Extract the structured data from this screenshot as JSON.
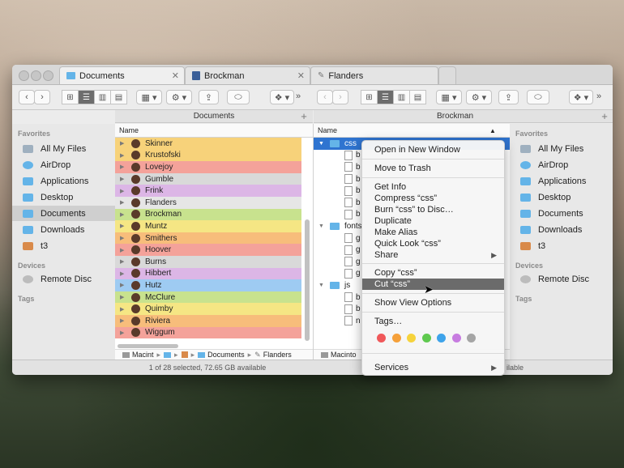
{
  "tabs": [
    {
      "label": "Documents",
      "icon": "folder-icon"
    },
    {
      "label": "Brockman",
      "icon": "book-icon"
    },
    {
      "label": "Flanders",
      "icon": "pencil-icon"
    }
  ],
  "left_pane": {
    "path_header": "Documents",
    "column_name": "Name",
    "rows": [
      {
        "label": "Skinner",
        "color": "#f7d27a"
      },
      {
        "label": "Krustofski",
        "color": "#f7d27a"
      },
      {
        "label": "Lovejoy",
        "color": "#f4a29a"
      },
      {
        "label": "Gumble",
        "color": "#d9d9d9"
      },
      {
        "label": "Frink",
        "color": "#dcb6e6"
      },
      {
        "label": "Flanders",
        "color": "#e6e6e6"
      },
      {
        "label": "Brockman",
        "color": "#c8e28e"
      },
      {
        "label": "Muntz",
        "color": "#f5e684"
      },
      {
        "label": "Smithers",
        "color": "#f7bd7b"
      },
      {
        "label": "Hoover",
        "color": "#f4a29a"
      },
      {
        "label": "Burns",
        "color": "#d9d9d9"
      },
      {
        "label": "Hibbert",
        "color": "#dcb6e6"
      },
      {
        "label": "Hutz",
        "color": "#9ecbf2"
      },
      {
        "label": "McClure",
        "color": "#c8e28e"
      },
      {
        "label": "Quimby",
        "color": "#f5e684"
      },
      {
        "label": "Riviera",
        "color": "#f7bd7b"
      },
      {
        "label": "Wiggum",
        "color": "#f4a29a"
      }
    ],
    "breadcrumb": [
      "Macint",
      "Documents",
      "Flanders"
    ]
  },
  "right_pane": {
    "path_header": "Brockman",
    "column_name": "Name",
    "rows": [
      "css",
      "b",
      "b",
      "b",
      "b",
      "b",
      "b",
      "fonts",
      "g",
      "g",
      "g",
      "g",
      "js",
      "b",
      "b",
      "n"
    ],
    "breadcrumb": [
      "Macinto"
    ],
    "status_tail": "ilable"
  },
  "sidebar": {
    "favorites_header": "Favorites",
    "favorites": [
      "All My Files",
      "AirDrop",
      "Applications",
      "Desktop",
      "Documents",
      "Downloads",
      "t3"
    ],
    "devices_header": "Devices",
    "devices": [
      "Remote Disc"
    ],
    "tags_header": "Tags"
  },
  "status_left": "1 of 28 selected, 72.65 GB available",
  "context_menu": {
    "items": [
      "Open in New Window",
      "Move to Trash",
      "Get Info",
      "Compress “css”",
      "Burn “css” to Disc…",
      "Duplicate",
      "Make Alias",
      "Quick Look “css”",
      "Share",
      "Copy “css”",
      "Cut “css”",
      "Show View Options",
      "Tags…",
      "Services"
    ],
    "highlighted": "Cut “css”",
    "tag_colors": [
      "#f0585a",
      "#f5a03a",
      "#f6d33c",
      "#5fc94f",
      "#3ea3ea",
      "#c77ce0",
      "#a5a5a5"
    ]
  }
}
